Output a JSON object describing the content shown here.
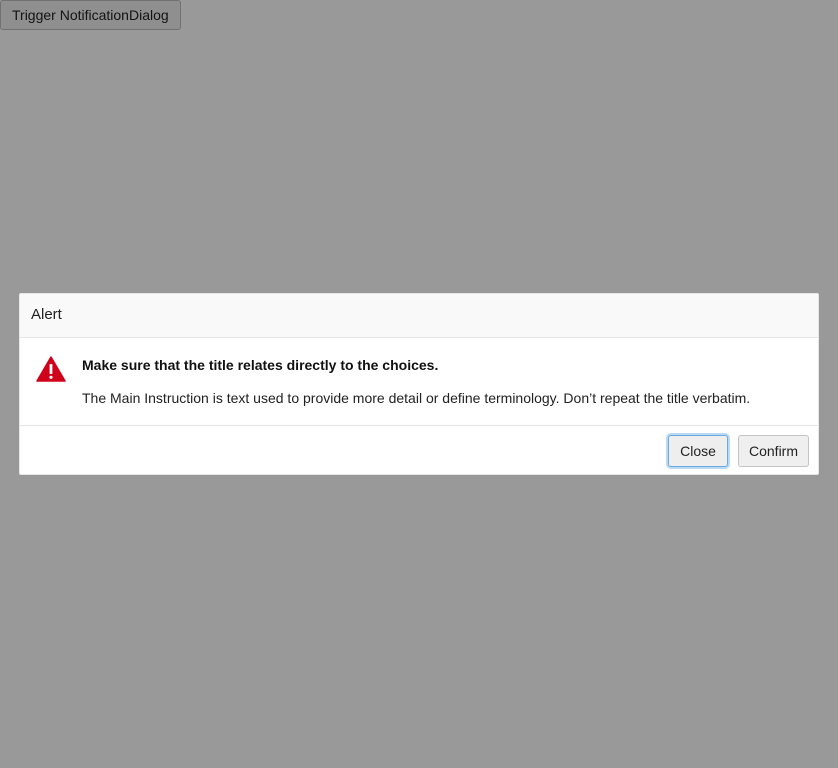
{
  "trigger": {
    "label": "Trigger NotificationDialog"
  },
  "dialog": {
    "title": "Alert",
    "icon": "warning-icon",
    "icon_color": "#d0021b",
    "main_instruction": "Make sure that the title relates directly to the choices.",
    "detail": "The Main Instruction is text used to provide more detail or define terminology. Don’t repeat the title verbatim.",
    "buttons": {
      "close_label": "Close",
      "confirm_label": "Confirm"
    }
  },
  "colors": {
    "overlay": "#999999",
    "focus_ring": "#6aa9e0"
  }
}
